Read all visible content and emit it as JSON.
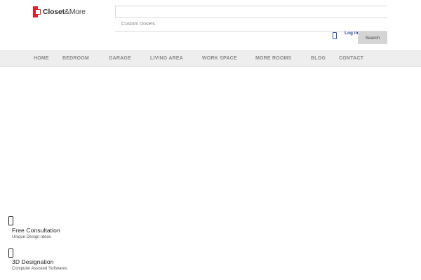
{
  "header": {
    "logo": {
      "brand": "Closet",
      "suffix": "&More"
    },
    "search": {
      "value": "",
      "placeholder": "",
      "hint": "Custom closets",
      "button_label": "Search"
    },
    "login_label": "Log in"
  },
  "nav": {
    "items": [
      {
        "label": "HOME"
      },
      {
        "label": "BEDROOM"
      },
      {
        "label": "GARAGE"
      },
      {
        "label": "LIVING AREA"
      },
      {
        "label": "WORK SPACE"
      },
      {
        "label": "MORE ROOMS"
      },
      {
        "label": "BLOG"
      },
      {
        "label": "CONTACT"
      }
    ]
  },
  "features": [
    {
      "title": "Free Consultation",
      "subtitle": "Unique Design Ideas",
      "icon": "feature-icon"
    },
    {
      "title": "3D Designation",
      "subtitle": "Computer Assisted Softwares",
      "icon": "feature-icon"
    }
  ],
  "colors": {
    "brand_red": "#d6232f",
    "link_blue": "#2d4f96",
    "nav_bg": "#eeeeee",
    "button_bg": "#d4d4d4"
  }
}
